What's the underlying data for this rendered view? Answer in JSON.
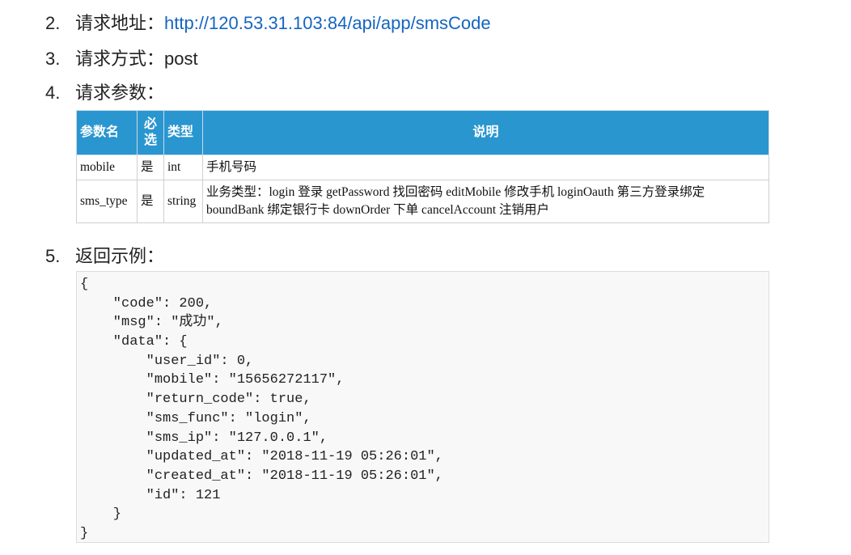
{
  "items": [
    {
      "num": "2.",
      "label": "请求地址：",
      "value": "http://120.53.31.103:84/api/app/smsCode"
    },
    {
      "num": "3.",
      "label": "请求方式：",
      "value": "post"
    },
    {
      "num": "4.",
      "label": "请求参数："
    },
    {
      "num": "5.",
      "label": "返回示例："
    }
  ],
  "table": {
    "headers": [
      "参数名",
      "必\n选",
      "类型",
      "说明"
    ],
    "rows": [
      [
        "mobile",
        "是",
        "int",
        "手机号码"
      ],
      [
        "sms_type",
        "是",
        "string",
        "业务类型：login 登录 getPassword 找回密码 editMobile 修改手机 loginOauth 第三方登录绑定 boundBank 绑定银行卡 downOrder 下单 cancelAccount 注销用户"
      ]
    ]
  },
  "code_lines": [
    "{",
    "    \"code\": 200,",
    "    \"msg\": \"成功\",",
    "    \"data\": {",
    "        \"user_id\": 0,",
    "        \"mobile\": \"15656272117\",",
    "        \"return_code\": true,",
    "        \"sms_func\": \"login\",",
    "        \"sms_ip\": \"127.0.0.1\",",
    "        \"updated_at\": \"2018-11-19 05:26:01\",",
    "        \"created_at\": \"2018-11-19 05:26:01\",",
    "        \"id\": 121",
    "    }",
    "}"
  ]
}
